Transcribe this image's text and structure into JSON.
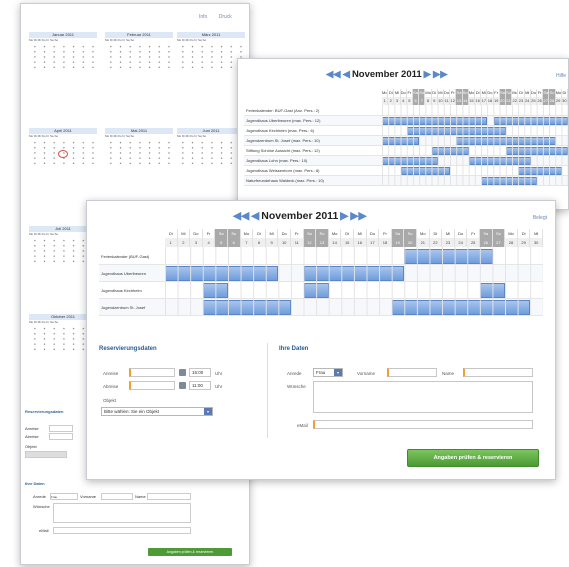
{
  "back": {
    "icons": [
      "Info",
      "Druck"
    ],
    "months": [
      "Januar 2011",
      "Februar 2011",
      "März 2011",
      "April 2011",
      "Mai 2011",
      "Juni 2011",
      "Juli 2011",
      "",
      "",
      "Oktober 2011",
      "",
      ""
    ],
    "weekday_row": "Mo Di Mi Do Fr Sa So",
    "form": {
      "section1": "Reservierungsdaten",
      "l_anreise": "Anreise",
      "l_abreise": "Abreise",
      "l_objekt": "Objekt",
      "section2": "Ihre Daten",
      "l_anrede": "Anrede",
      "anrede_value": "Frau",
      "l_vorname": "Vorname",
      "l_name": "Name",
      "l_wunsche": "Wünsche",
      "l_email": "eMail",
      "button": "Angaben prüfen & reservieren"
    }
  },
  "mid": {
    "title": "November 2011",
    "legend": "Hilfe",
    "weekdays": [
      "Mo",
      "Di",
      "Mi",
      "Do",
      "Fr",
      "Sa",
      "So",
      "Mo",
      "Di",
      "Mi",
      "Do",
      "Fr",
      "Sa",
      "So",
      "Mo",
      "Di",
      "Mi",
      "Do",
      "Fr",
      "Sa",
      "So",
      "Mo",
      "Di",
      "Mi",
      "Do",
      "Fr",
      "Sa",
      "So",
      "Mo",
      "Di"
    ],
    "days": [
      "1",
      "2",
      "3",
      "4",
      "5",
      "6",
      "7",
      "8",
      "9",
      "10",
      "11",
      "12",
      "13",
      "14",
      "15",
      "16",
      "17",
      "18",
      "19",
      "20",
      "21",
      "22",
      "23",
      "24",
      "25",
      "26",
      "27",
      "28",
      "29",
      "30"
    ],
    "rows": [
      "Ferienkalender: BUF-Gast (Anz. Pers.: 2)",
      "Jugendhaus Uberlbeuren (max. Pers.: 12)",
      "Jugendhaus Kirchheim (max. Pers.: 6)",
      "Jugendzentrum St. Josef (max. Pers.: 10)",
      "Stiftung Schöne Aussicht (max. Pers.: 12)",
      "Jugendhaus Lohn (max. Pers.: 10)",
      "Jugendhaus Weissenhorn (max. Pers.: 8)",
      "Naturfreundehaus Waldeck (max. Pers.: 10)"
    ]
  },
  "front": {
    "title": "November 2011",
    "legend": "Belegt",
    "weekdays": [
      "Di",
      "Mi",
      "Do",
      "Fr",
      "Sa",
      "So",
      "Mo",
      "Di",
      "Mi",
      "Do",
      "Fr",
      "Sa",
      "So",
      "Mo",
      "Di",
      "Mi",
      "Do",
      "Fr",
      "Sa",
      "So",
      "Mo",
      "Di",
      "Mi",
      "Do",
      "Fr",
      "Sa",
      "So",
      "Mo",
      "Di",
      "Mi"
    ],
    "days": [
      "1",
      "2",
      "3",
      "4",
      "5",
      "6",
      "7",
      "8",
      "9",
      "10",
      "11",
      "12",
      "13",
      "14",
      "15",
      "16",
      "17",
      "18",
      "19",
      "20",
      "21",
      "22",
      "23",
      "24",
      "25",
      "26",
      "27",
      "28",
      "29",
      "30"
    ],
    "rows": [
      "Ferienkalender (BUF-Gast)",
      "Jugendhaus Uberlbeuren",
      "Jugendhaus Kirchheim",
      "Jugendzentrum St. Josef"
    ],
    "reservation": {
      "title": "Reservierungsdaten",
      "anreise_label": "Anreise",
      "abreise_label": "Abreise",
      "time1": "15:00",
      "time2": "11:00",
      "uhr": "Uhr",
      "objekt_label": "Objekt",
      "objekt_value": "Bitte wählen: Sie ein Objekt",
      "select_arrow": "▾"
    },
    "personal": {
      "title": "Ihre Daten",
      "anrede_label": "Anrede",
      "anrede_value": "Frau",
      "vorname_label": "Vorname",
      "name_label": "Name",
      "wunsche_label": "Wünsche",
      "email_label": "eMail"
    },
    "button": "Angaben prüfen & reservieren"
  },
  "colors": {
    "bar": "#6f9ddd",
    "weekend": "#a9a9a9",
    "button": "#4b9a34",
    "required": "#f0a12a"
  }
}
